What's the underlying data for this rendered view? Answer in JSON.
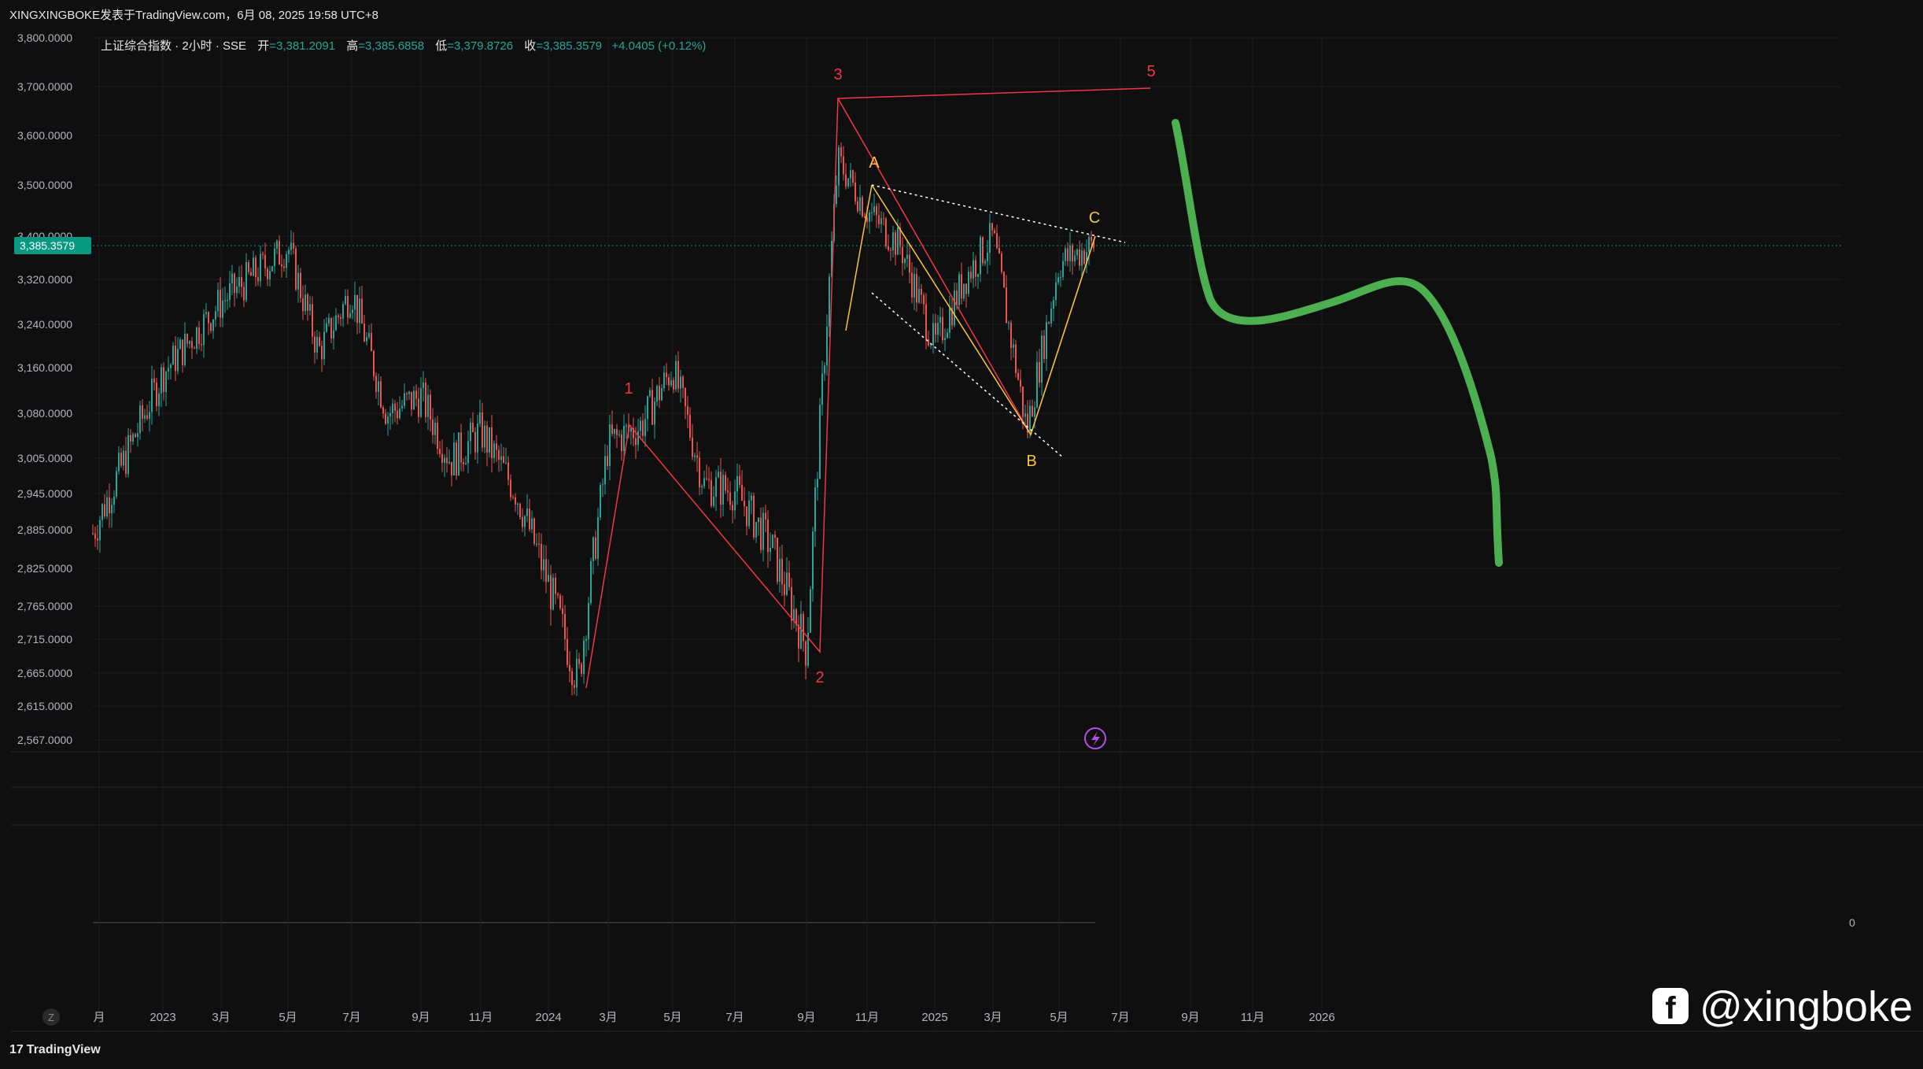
{
  "header": {
    "publish_line": "XINGXINGBOKE发表于TradingView.com，6月 08, 2025 19:58 UTC+8"
  },
  "legend": {
    "symbol": "上证综合指数 · 2小时 · SSE",
    "open_label": "开",
    "open": "=3,381.2091",
    "high_label": "高",
    "high": "=3,385.6858",
    "low_label": "低",
    "low": "=3,379.8726",
    "close_label": "收",
    "close": "=3,385.3579",
    "change": "+4.0405 (+0.12%)"
  },
  "colors": {
    "up": "#26a69a",
    "down": "#ef5350",
    "price_tag": "#089981",
    "green_drawing": "#4caf50",
    "wave_red": "#f23645",
    "wave_yellow": "#f5c542"
  },
  "chart_data": {
    "type": "candlestick",
    "ylim": [
      2540,
      3820
    ],
    "y_tick_labels": [
      "3,800.0000",
      "3,700.0000",
      "3,600.0000",
      "3,500.0000",
      "3,400.0000",
      "3,320.0000",
      "3,240.0000",
      "3,160.0000",
      "3,080.0000",
      "3,005.0000",
      "2,945.0000",
      "2,885.0000",
      "2,825.0000",
      "2,765.0000",
      "2,715.0000",
      "2,665.0000",
      "2,615.0000",
      "2,567.0000"
    ],
    "x_tick_labels": [
      "月",
      "2023",
      "3月",
      "5月",
      "7月",
      "9月",
      "11月",
      "2024",
      "3月",
      "5月",
      "7月",
      "9月",
      "11月",
      "2025",
      "3月",
      "5月",
      "7月",
      "9月",
      "11月",
      "2026"
    ],
    "last_price": "3,385.3579",
    "indicator_value": "0",
    "approx_close_path": [
      [
        "2022-12",
        2880
      ],
      [
        "2023-01",
        3150
      ],
      [
        "2023-03",
        3280
      ],
      [
        "2023-05",
        3380
      ],
      [
        "2023-06",
        3190
      ],
      [
        "2023-07",
        3300
      ],
      [
        "2023-08",
        3080
      ],
      [
        "2023-09",
        3110
      ],
      [
        "2023-10",
        3000
      ],
      [
        "2023-11",
        3050
      ],
      [
        "2023-12",
        2950
      ],
      [
        "2024-01",
        2800
      ],
      [
        "2024-02",
        2650
      ],
      [
        "2024-03",
        3030
      ],
      [
        "2024-04",
        3060
      ],
      [
        "2024-05",
        3160
      ],
      [
        "2024-06",
        2960
      ],
      [
        "2024-07",
        2950
      ],
      [
        "2024-08",
        2860
      ],
      [
        "2024-09",
        2700
      ],
      [
        "2024-10",
        3550
      ],
      [
        "2024-11",
        3450
      ],
      [
        "2024-12",
        3380
      ],
      [
        "2025-01",
        3200
      ],
      [
        "2025-02",
        3320
      ],
      [
        "2025-03",
        3400
      ],
      [
        "2025-04",
        3050
      ],
      [
        "2025-05",
        3350
      ],
      [
        "2025-06",
        3385
      ]
    ],
    "wave_labels": [
      {
        "label": "1",
        "date": "2024-04",
        "price": 3080
      },
      {
        "label": "2",
        "date": "2024-09",
        "price": 2690
      },
      {
        "label": "3",
        "date": "2024-10",
        "price": 3670
      },
      {
        "label": "5",
        "date": "2025-07",
        "price": 3680
      },
      {
        "label": "A",
        "date": "2024-11",
        "price": 3500
      },
      {
        "label": "B",
        "date": "2025-04",
        "price": 3040
      },
      {
        "label": "C",
        "date": "2025-06",
        "price": 3400
      }
    ]
  },
  "annotations": {
    "wave_1": "1",
    "wave_2": "2",
    "wave_3": "3",
    "wave_5": "5",
    "wave_a": "A",
    "wave_b": "B",
    "wave_c": "C"
  },
  "footer": {
    "brand": "TradingView",
    "watermark": "@xingboke",
    "goto_button": "Z"
  }
}
